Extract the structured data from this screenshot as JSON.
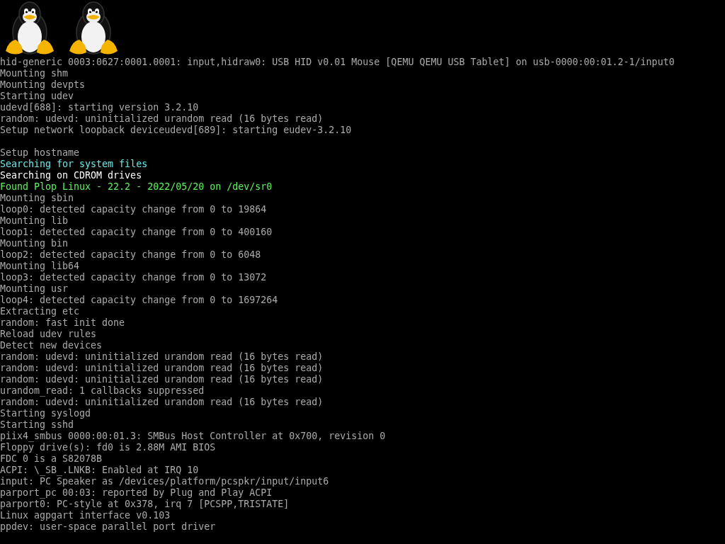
{
  "boot_logos": [
    {
      "kind": "penguin"
    },
    {
      "kind": "penguin"
    }
  ],
  "console_lines": [
    {
      "kind": "normal",
      "text": "hid-generic 0003:0627:0001.0001: input,hidraw0: USB HID v0.01 Mouse [QEMU QEMU USB Tablet] on usb-0000:00:01.2-1/input0"
    },
    {
      "kind": "normal",
      "text": "Mounting shm"
    },
    {
      "kind": "normal",
      "text": "Mounting devpts"
    },
    {
      "kind": "normal",
      "text": "Starting udev"
    },
    {
      "kind": "normal",
      "text": "udevd[688]: starting version 3.2.10"
    },
    {
      "kind": "normal",
      "text": "random: udevd: uninitialized urandom read (16 bytes read)"
    },
    {
      "kind": "normal",
      "text": "Setup network loopback deviceudevd[689]: starting eudev-3.2.10"
    },
    {
      "kind": "blank"
    },
    {
      "kind": "normal",
      "text": "Setup hostname"
    },
    {
      "kind": "info",
      "text": "Searching for system files"
    },
    {
      "kind": "bright",
      "text": "Searching on CDROM drives"
    },
    {
      "kind": "success",
      "text": "Found Plop Linux - 22.2 - 2022/05/20 on /dev/sr0"
    },
    {
      "kind": "normal",
      "text": "Mounting sbin"
    },
    {
      "kind": "normal",
      "text": "loop0: detected capacity change from 0 to 19864"
    },
    {
      "kind": "normal",
      "text": "Mounting lib"
    },
    {
      "kind": "normal",
      "text": "loop1: detected capacity change from 0 to 400160"
    },
    {
      "kind": "normal",
      "text": "Mounting bin"
    },
    {
      "kind": "normal",
      "text": "loop2: detected capacity change from 0 to 6048"
    },
    {
      "kind": "normal",
      "text": "Mounting lib64"
    },
    {
      "kind": "normal",
      "text": "loop3: detected capacity change from 0 to 13072"
    },
    {
      "kind": "normal",
      "text": "Mounting usr"
    },
    {
      "kind": "normal",
      "text": "loop4: detected capacity change from 0 to 1697264"
    },
    {
      "kind": "normal",
      "text": "Extracting etc"
    },
    {
      "kind": "normal",
      "text": "random: fast init done"
    },
    {
      "kind": "normal",
      "text": "Reload udev rules"
    },
    {
      "kind": "normal",
      "text": "Detect new devices"
    },
    {
      "kind": "normal",
      "text": "random: udevd: uninitialized urandom read (16 bytes read)"
    },
    {
      "kind": "normal",
      "text": "random: udevd: uninitialized urandom read (16 bytes read)"
    },
    {
      "kind": "normal",
      "text": "random: udevd: uninitialized urandom read (16 bytes read)"
    },
    {
      "kind": "normal",
      "text": "urandom_read: 1 callbacks suppressed"
    },
    {
      "kind": "normal",
      "text": "random: udevd: uninitialized urandom read (16 bytes read)"
    },
    {
      "kind": "normal",
      "text": "Starting syslogd"
    },
    {
      "kind": "normal",
      "text": "Starting sshd"
    },
    {
      "kind": "normal",
      "text": "piix4_smbus 0000:00:01.3: SMBus Host Controller at 0x700, revision 0"
    },
    {
      "kind": "normal",
      "text": "Floppy drive(s): fd0 is 2.88M AMI BIOS"
    },
    {
      "kind": "normal",
      "text": "FDC 0 is a S82078B"
    },
    {
      "kind": "normal",
      "text": "ACPI: \\_SB_.LNKB: Enabled at IRQ 10"
    },
    {
      "kind": "normal",
      "text": "input: PC Speaker as /devices/platform/pcspkr/input/input6"
    },
    {
      "kind": "normal",
      "text": "parport_pc 00:03: reported by Plug and Play ACPI"
    },
    {
      "kind": "normal",
      "text": "parport0: PC-style at 0x378, irq 7 [PCSPP,TRISTATE]"
    },
    {
      "kind": "normal",
      "text": "Linux agpgart interface v0.103"
    },
    {
      "kind": "normal",
      "text": "ppdev: user-space parallel port driver"
    }
  ]
}
